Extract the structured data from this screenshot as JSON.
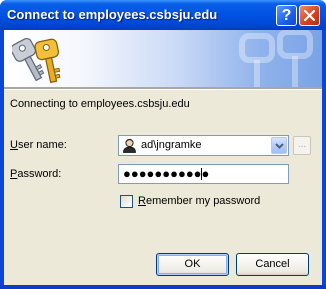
{
  "window": {
    "title": "Connect to employees.csbsju.edu",
    "help_button": "?",
    "close_button": "close"
  },
  "dialog": {
    "message": "Connecting to employees.csbsju.edu",
    "username_label_accel": "U",
    "username_label_rest": "ser name:",
    "username_value": "ad\\jngramke",
    "browse_label": "...",
    "password_label_accel": "P",
    "password_label_rest": "assword:",
    "password_masked": "●●●●●●●●●●●",
    "remember_label_accel": "R",
    "remember_label_rest": "emember my password",
    "remember_checked": false,
    "ok_label": "OK",
    "cancel_label": "Cancel"
  },
  "icons": {
    "banner": "keys-icon",
    "user": "user-icon",
    "dropdown": "chevron-down-icon",
    "close": "close-icon"
  },
  "colors": {
    "titlebar": "#0054e3",
    "client_bg": "#ece9d8",
    "field_border": "#7f9db9",
    "button_border": "#003c74"
  }
}
